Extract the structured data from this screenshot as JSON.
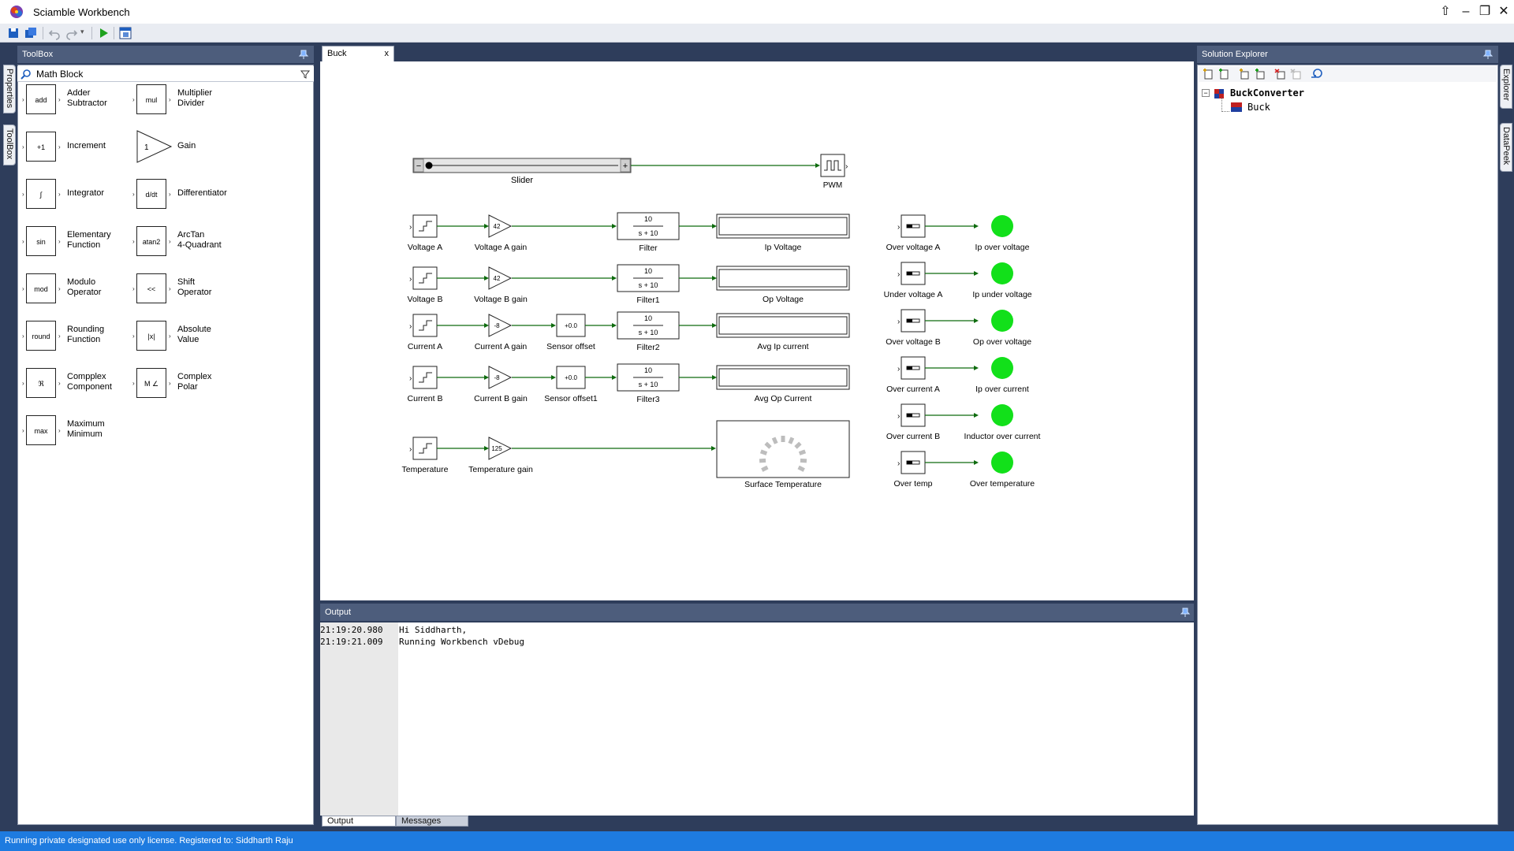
{
  "window": {
    "title": "Sciamble Workbench"
  },
  "toolbox": {
    "header": "ToolBox",
    "category": "Math Block",
    "items": [
      {
        "label": "Adder\nSubtractor",
        "glyph": "add"
      },
      {
        "label": "Multiplier\nDivider",
        "glyph": "mul"
      },
      {
        "label": "Increment",
        "glyph": "+1"
      },
      {
        "label": "Gain",
        "glyph": "1"
      },
      {
        "label": "Integrator",
        "glyph": "∫"
      },
      {
        "label": "Differentiator",
        "glyph": "d/dt"
      },
      {
        "label": "Elementary\nFunction",
        "glyph": "sin"
      },
      {
        "label": "ArcTan\n4-Quadrant",
        "glyph": "atan2"
      },
      {
        "label": "Modulo\nOperator",
        "glyph": "mod"
      },
      {
        "label": "Shift\nOperator",
        "glyph": "<<"
      },
      {
        "label": "Rounding\nFunction",
        "glyph": "round"
      },
      {
        "label": "Absolute\nValue",
        "glyph": "|x|"
      },
      {
        "label": "Compplex\nComponent",
        "glyph": "ℜ"
      },
      {
        "label": "Complex\nPolar",
        "glyph": "M ∠"
      },
      {
        "label": "Maximum\nMinimum",
        "glyph": "max"
      }
    ]
  },
  "side_tabs": {
    "left": [
      "Properties",
      "ToolBox"
    ],
    "right": [
      "Explorer",
      "DataPeek"
    ]
  },
  "document": {
    "tab": "Buck",
    "close": "x",
    "slider": {
      "label": "Slider",
      "minus": "−",
      "plus": "+"
    },
    "pwm": {
      "label": "PWM"
    },
    "sources": [
      "Voltage A",
      "Voltage B",
      "Current A",
      "Current B",
      "Temperature"
    ],
    "gains": [
      {
        "label": "Voltage A gain",
        "value": "42"
      },
      {
        "label": "Voltage B gain",
        "value": "42"
      },
      {
        "label": "Current A gain",
        "value": "-8"
      },
      {
        "label": "Current B gain",
        "value": "-8"
      },
      {
        "label": "Temperature gain",
        "value": "125"
      }
    ],
    "offsets": [
      {
        "label": "Sensor offset",
        "value": "+0.0"
      },
      {
        "label": "Sensor offset1",
        "value": "+0.0"
      }
    ],
    "filters": [
      {
        "label": "Filter",
        "num": "10",
        "den": "s + 10"
      },
      {
        "label": "Filter1",
        "num": "10",
        "den": "s + 10"
      },
      {
        "label": "Filter2",
        "num": "10",
        "den": "s + 10"
      },
      {
        "label": "Filter3",
        "num": "10",
        "den": "s + 10"
      }
    ],
    "displays": [
      "Ip Voltage",
      "Op Voltage",
      "Avg Ip current",
      "Avg Op Current"
    ],
    "gauge": {
      "label": "Surface Temperature"
    },
    "switches": [
      "Over voltage A",
      "Under voltage A",
      "Over voltage B",
      "Over current A",
      "Over current B",
      "Over temp"
    ],
    "leds": [
      "Ip over voltage",
      "Ip under voltage",
      "Op over voltage",
      "Ip over current",
      "Inductor over current",
      "Over temperature"
    ],
    "colors": {
      "wire": "#0e6b0e",
      "led": "#12e01a"
    }
  },
  "output": {
    "header": "Output",
    "lines": [
      {
        "time": "21:19:20.980",
        "text": "Hi Siddharth,"
      },
      {
        "time": "21:19:21.009",
        "text": "Running Workbench vDebug"
      }
    ],
    "tabs": [
      "Output",
      "Messages"
    ]
  },
  "solution": {
    "header": "Solution Explorer",
    "root": "BuckConverter",
    "child": "Buck",
    "collapse": "−"
  },
  "status": {
    "text": "Running private designated use only license. Registered to: Siddharth Raju"
  }
}
